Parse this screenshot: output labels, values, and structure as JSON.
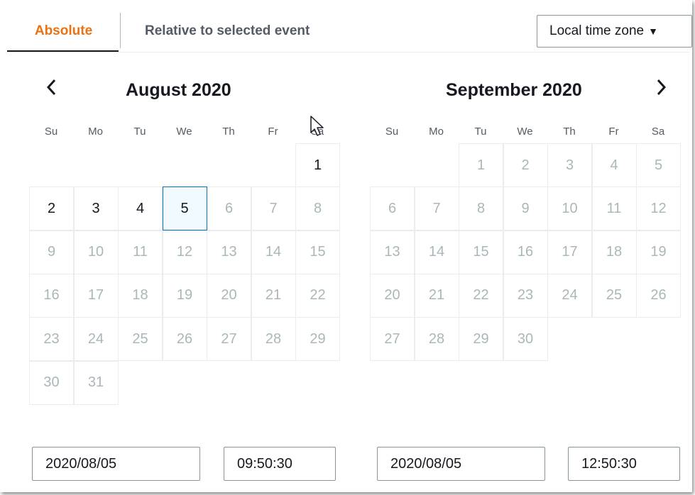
{
  "tabs": {
    "absolute": "Absolute",
    "relative": "Relative to selected event"
  },
  "timezone": {
    "label": "Local time zone",
    "caret": "▼"
  },
  "nav": {
    "prev": "‹",
    "next": "›"
  },
  "weekdays": [
    "Su",
    "Mo",
    "Tu",
    "We",
    "Th",
    "Fr",
    "Sa"
  ],
  "calendars": [
    {
      "title": "August 2020",
      "first_weekday": 6,
      "days": 31,
      "enabled_days": [
        1,
        2,
        3,
        4,
        5
      ],
      "selected_day": 5
    },
    {
      "title": "September 2020",
      "first_weekday": 2,
      "days": 30,
      "enabled_days": [],
      "selected_day": null
    }
  ],
  "range": {
    "start_date": "2020/08/05",
    "start_time": "09:50:30",
    "end_date": "2020/08/05",
    "end_time": "12:50:30"
  },
  "colors": {
    "accent": "#ec7211",
    "selected_border": "#0073bb",
    "disabled_text": "#aab7b8"
  }
}
